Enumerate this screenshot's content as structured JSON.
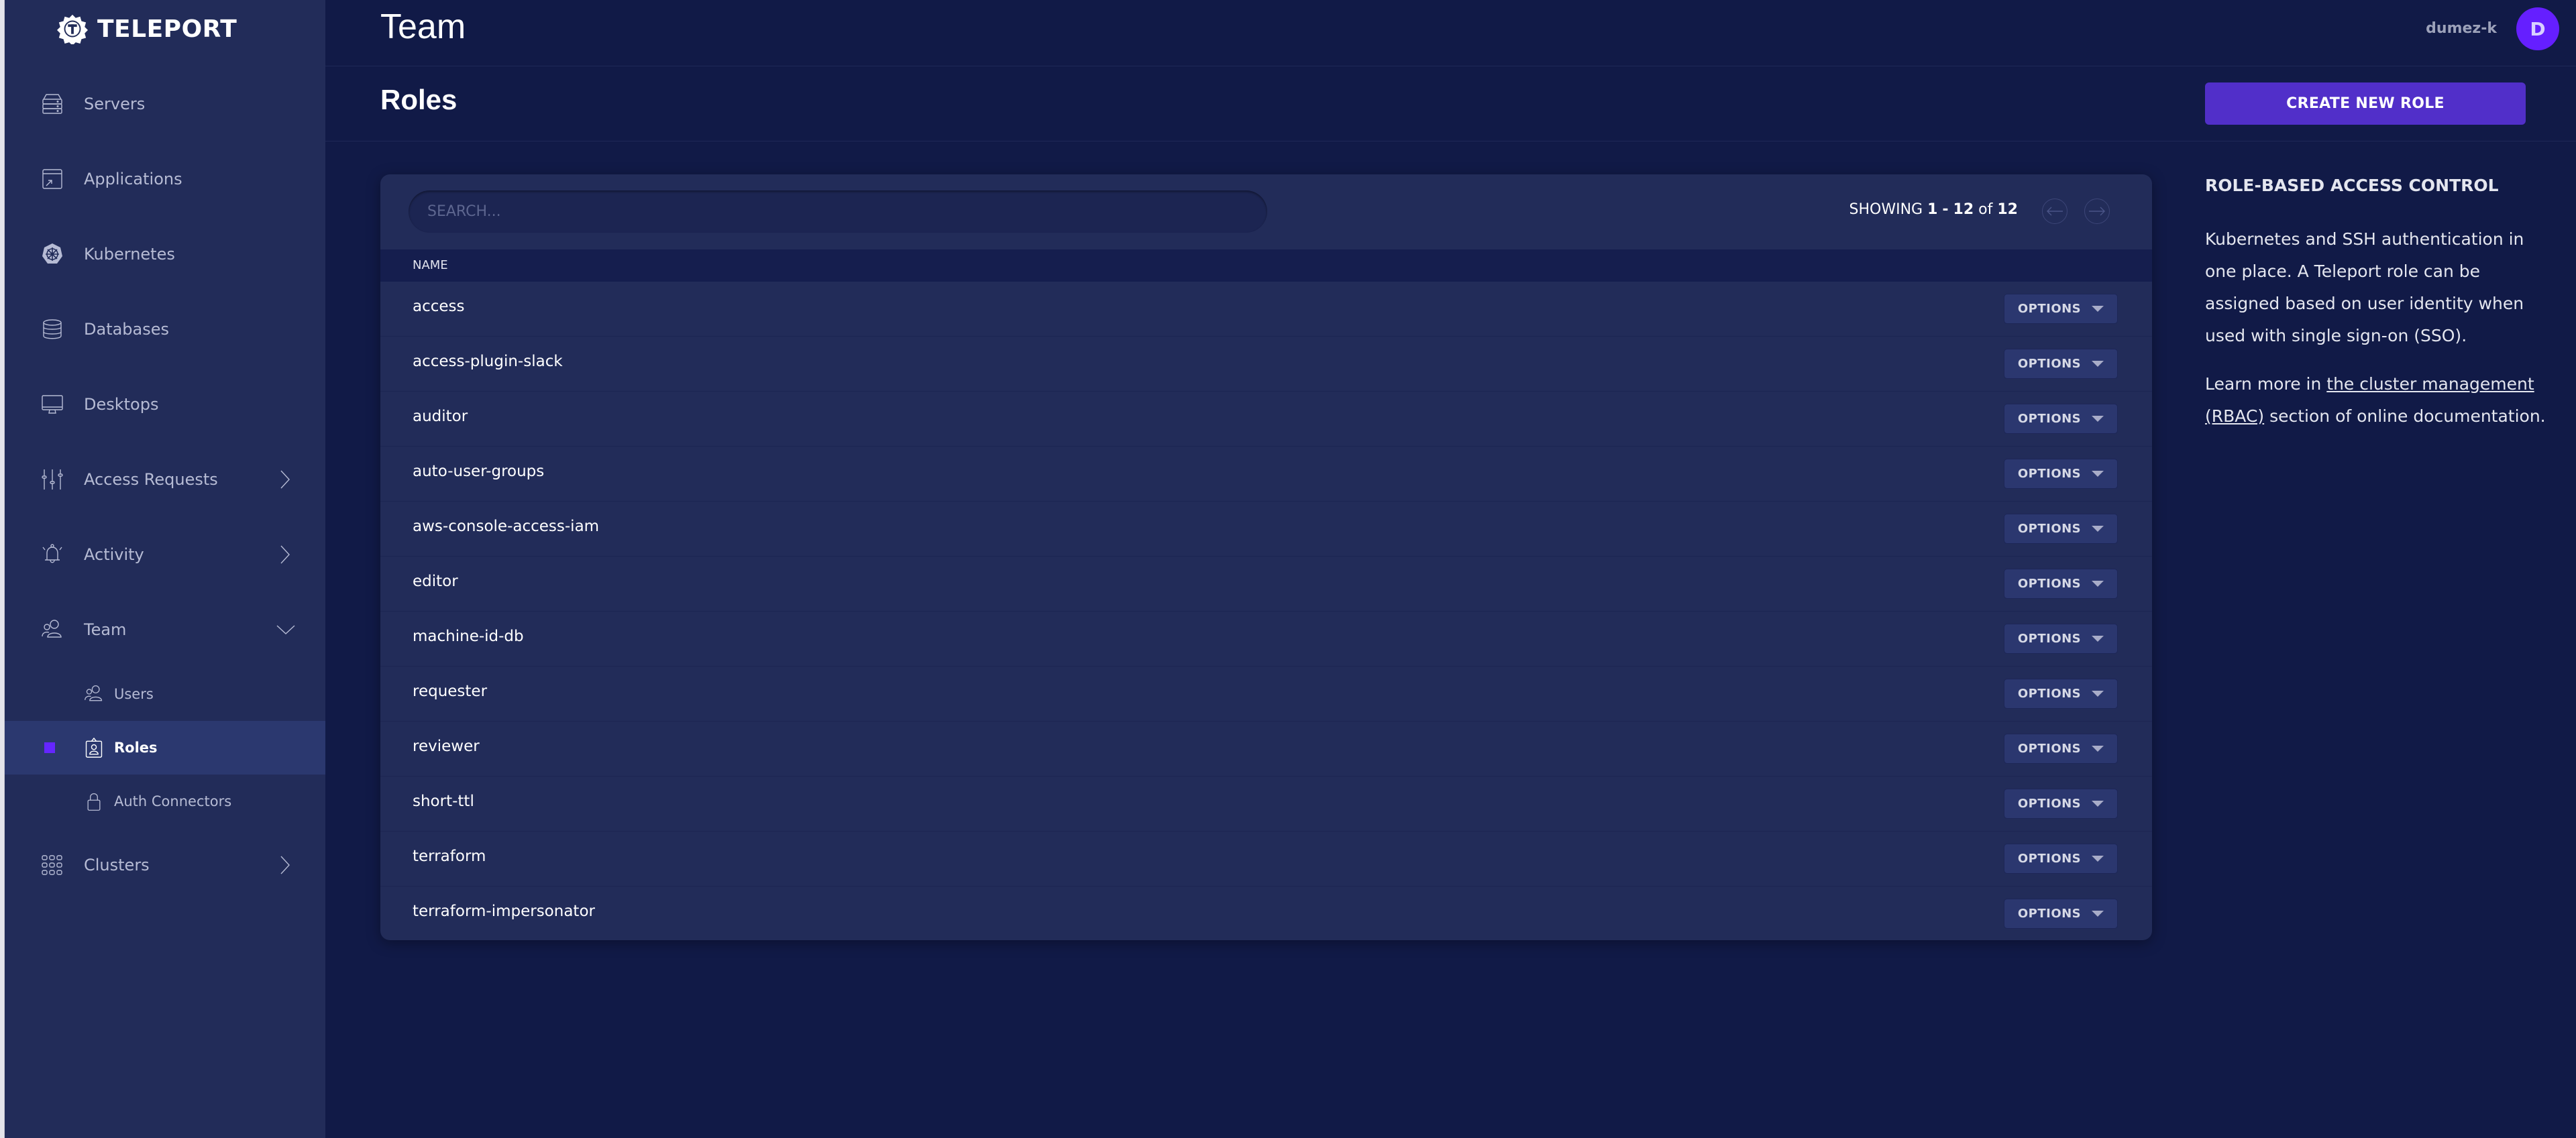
{
  "app": {
    "brand": "TELEPORT"
  },
  "sidebar": {
    "items": [
      {
        "label": "Servers",
        "icon": "server-icon",
        "expandable": false
      },
      {
        "label": "Applications",
        "icon": "application-icon",
        "expandable": false
      },
      {
        "label": "Kubernetes",
        "icon": "kubernetes-icon",
        "expandable": false
      },
      {
        "label": "Databases",
        "icon": "database-icon",
        "expandable": false
      },
      {
        "label": "Desktops",
        "icon": "desktop-icon",
        "expandable": false
      },
      {
        "label": "Access Requests",
        "icon": "sliders-icon",
        "expandable": true,
        "expanded": false
      },
      {
        "label": "Activity",
        "icon": "bell-icon",
        "expandable": true,
        "expanded": false
      },
      {
        "label": "Team",
        "icon": "users-icon",
        "expandable": true,
        "expanded": true
      },
      {
        "label": "Clusters",
        "icon": "grid-icon",
        "expandable": true,
        "expanded": false
      }
    ],
    "team_children": [
      {
        "label": "Users",
        "icon": "users-icon",
        "active": false
      },
      {
        "label": "Roles",
        "icon": "role-badge-icon",
        "active": true
      },
      {
        "label": "Auth Connectors",
        "icon": "lock-icon",
        "active": false
      }
    ]
  },
  "header": {
    "title": "Team",
    "username": "dumez-k",
    "avatar_initial": "D"
  },
  "subheader": {
    "title": "Roles",
    "create_button": "CREATE NEW ROLE"
  },
  "table": {
    "search_placeholder": "SEARCH...",
    "search_value": "",
    "pager": {
      "prefix": "SHOWING",
      "from": "1",
      "to": "12",
      "of_label": "of",
      "total": "12"
    },
    "columns": [
      "NAME"
    ],
    "option_label": "OPTIONS",
    "rows": [
      {
        "name": "access"
      },
      {
        "name": "access-plugin-slack"
      },
      {
        "name": "auditor"
      },
      {
        "name": "auto-user-groups"
      },
      {
        "name": "aws-console-access-iam"
      },
      {
        "name": "editor"
      },
      {
        "name": "machine-id-db"
      },
      {
        "name": "requester"
      },
      {
        "name": "reviewer"
      },
      {
        "name": "short-ttl"
      },
      {
        "name": "terraform"
      },
      {
        "name": "terraform-impersonator"
      }
    ]
  },
  "info_panel": {
    "title": "ROLE-BASED ACCESS CONTROL",
    "paragraph1": "Kubernetes and SSH authentication in one place. A Teleport role can be assigned based on user identity when used with single sign-on (SSO).",
    "learn_prefix": "Learn more in ",
    "learn_link": "the cluster management (RBAC)",
    "learn_suffix": " section of online documentation."
  },
  "colors": {
    "sidebar_bg": "#222c59",
    "main_bg": "#111a47",
    "accent": "#512fc9",
    "active_marker": "#6526ff",
    "avatar": "#651fff"
  }
}
